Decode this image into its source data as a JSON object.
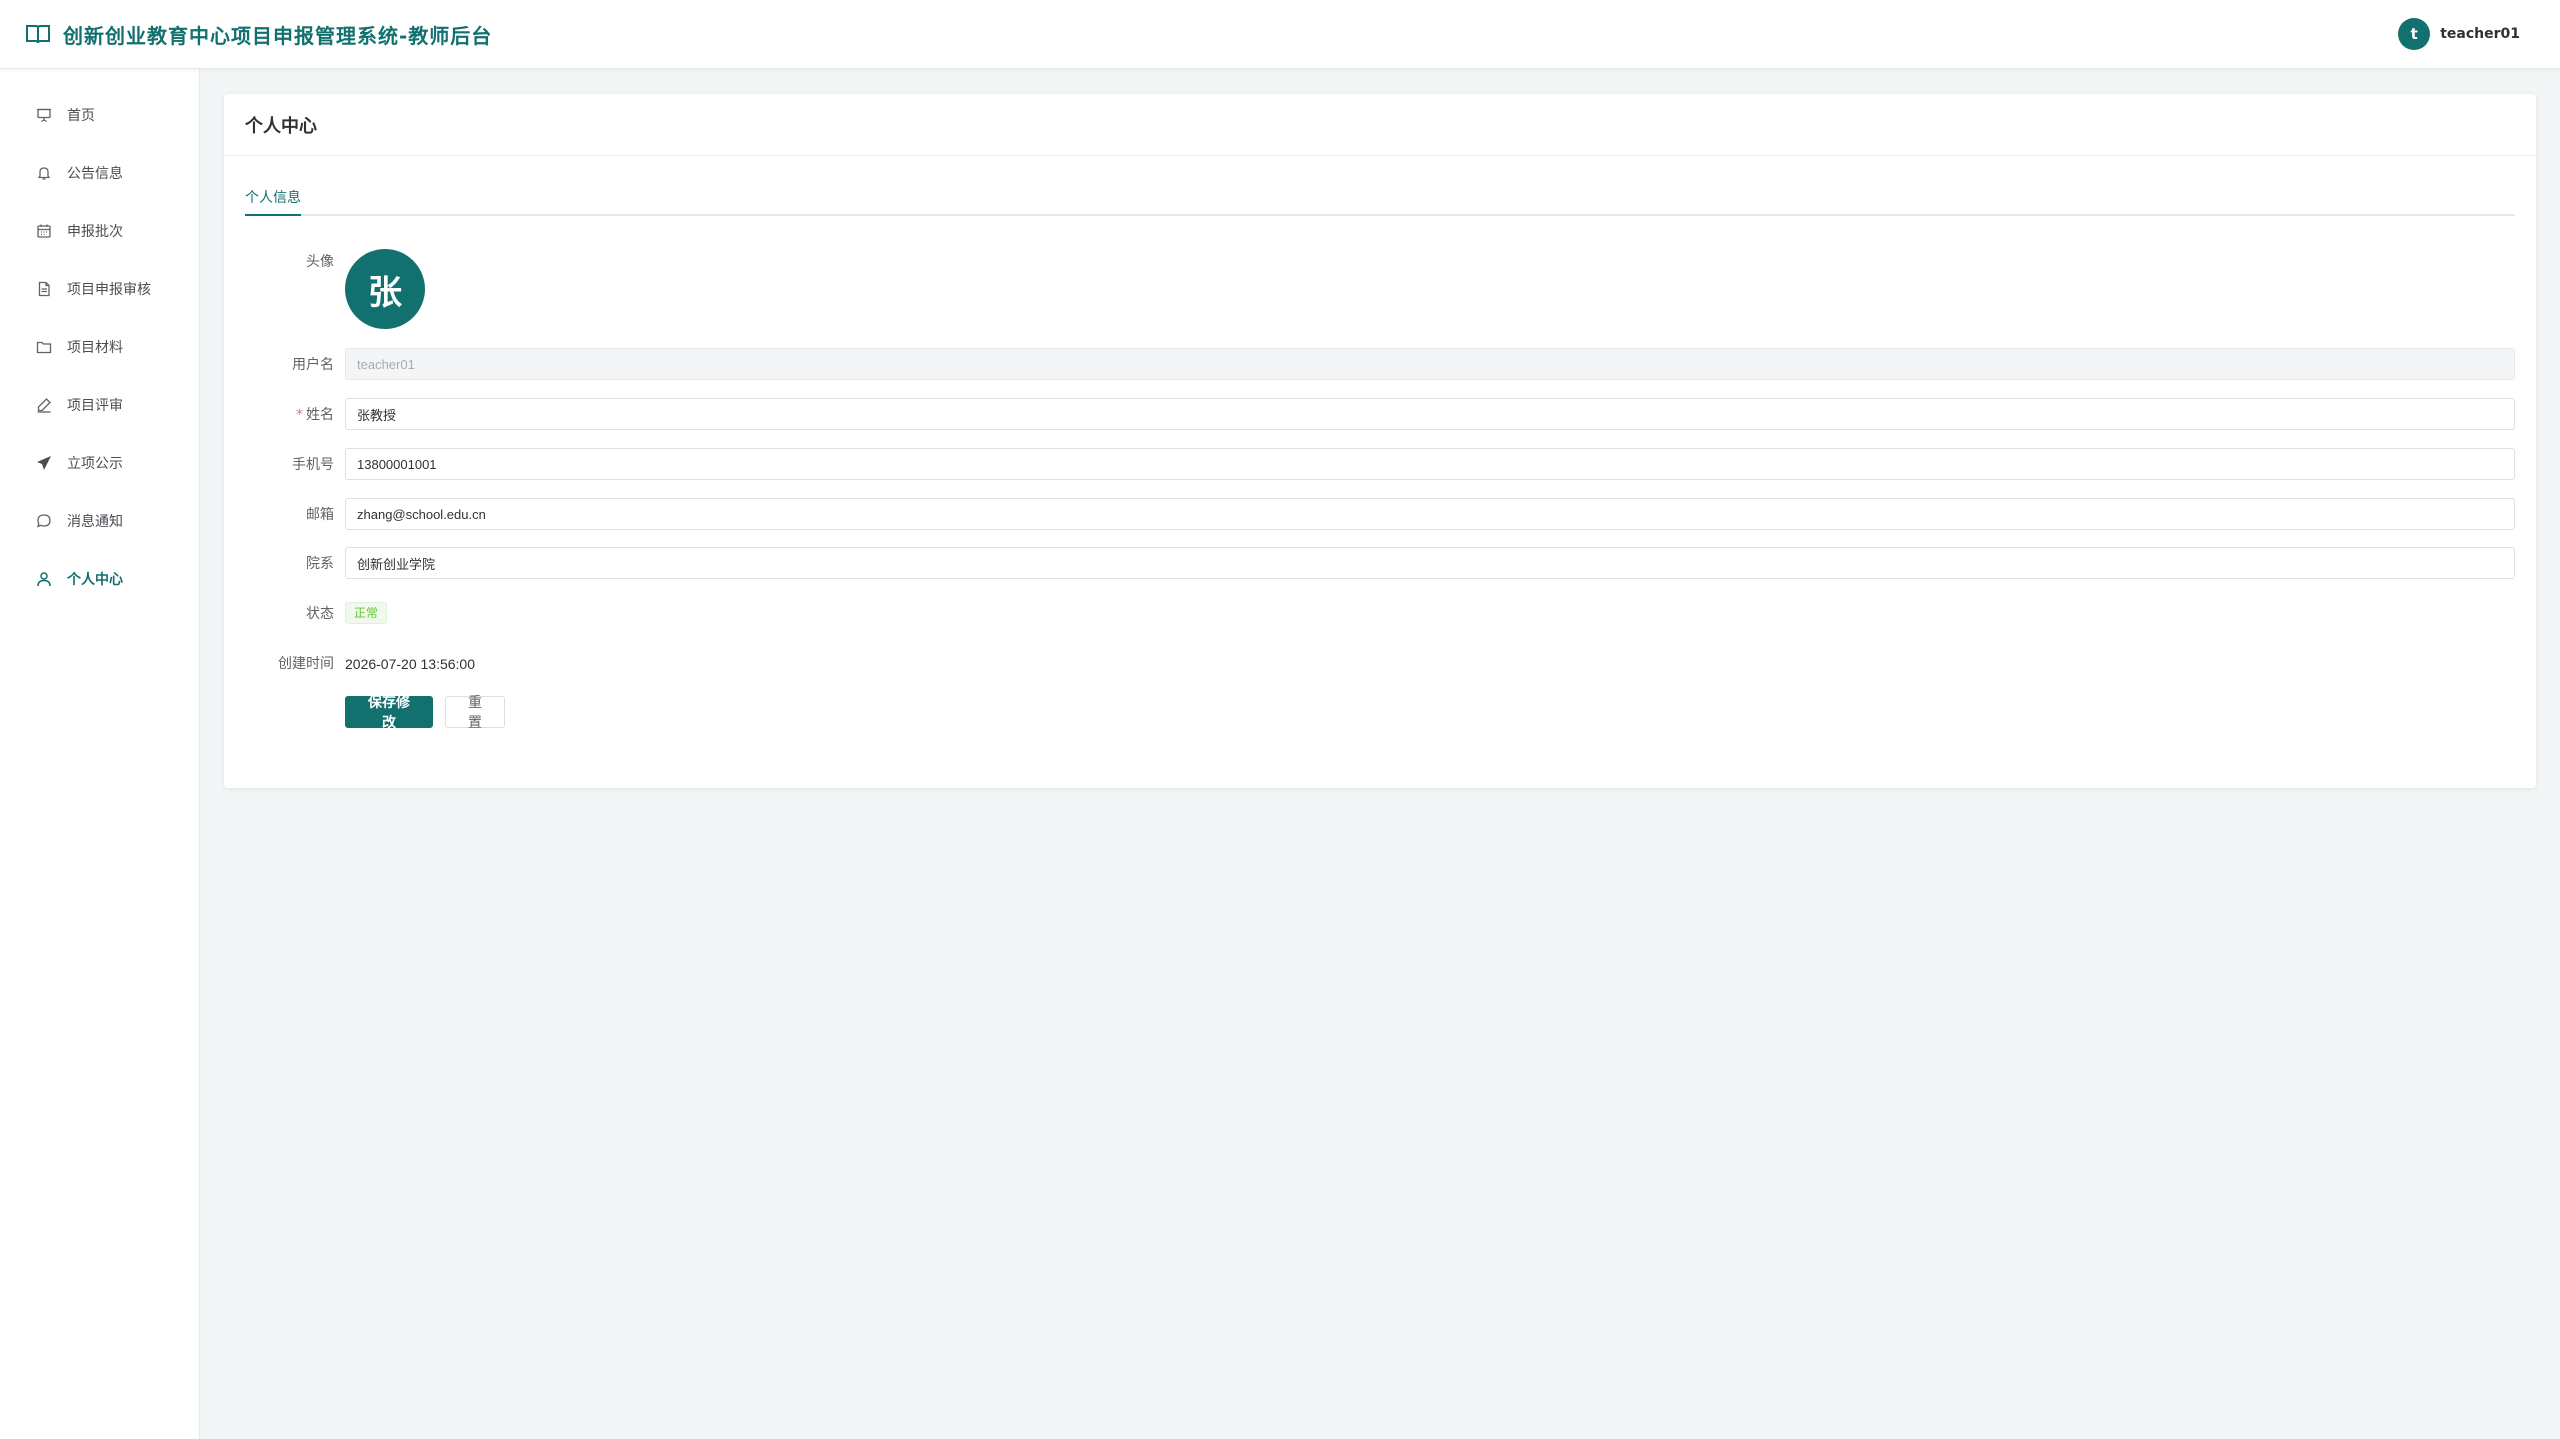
{
  "app": {
    "title": "创新创业教育中心项目申报管理系统-教师后台",
    "brand_color": "#12706f",
    "brand_icon": "book-open-icon"
  },
  "user": {
    "initial": "t",
    "name": "teacher01"
  },
  "sidebar": {
    "items": [
      {
        "label": "首页",
        "icon": "presentation-icon",
        "active": false
      },
      {
        "label": "公告信息",
        "icon": "bell-icon",
        "active": false
      },
      {
        "label": "申报批次",
        "icon": "calendar-icon",
        "active": false
      },
      {
        "label": "项目申报审核",
        "icon": "document-icon",
        "active": false
      },
      {
        "label": "项目材料",
        "icon": "folder-icon",
        "active": false
      },
      {
        "label": "项目评审",
        "icon": "pen-icon",
        "active": false
      },
      {
        "label": "立项公示",
        "icon": "send-icon",
        "active": false
      },
      {
        "label": "消息通知",
        "icon": "chat-icon",
        "active": false
      },
      {
        "label": "个人中心",
        "icon": "user-icon",
        "active": true
      }
    ]
  },
  "main": {
    "card_title": "个人中心",
    "tab_label": "个人信息",
    "form": {
      "avatar_label": "头像",
      "avatar_char": "张",
      "username_label": "用户名",
      "username_value": "teacher01",
      "name_required_mark": "*",
      "name_label": "姓名",
      "name_value": "张教授",
      "phone_label": "手机号",
      "phone_value": "13800001001",
      "email_label": "邮箱",
      "email_value": "zhang@school.edu.cn",
      "dept_label": "院系",
      "dept_value": "创新创业学院",
      "status_label": "状态",
      "status_value": "正常",
      "created_label": "创建时间",
      "created_value": "2026-07-20 13:56:00",
      "save_button": "保存修改",
      "reset_button": "重置"
    }
  }
}
